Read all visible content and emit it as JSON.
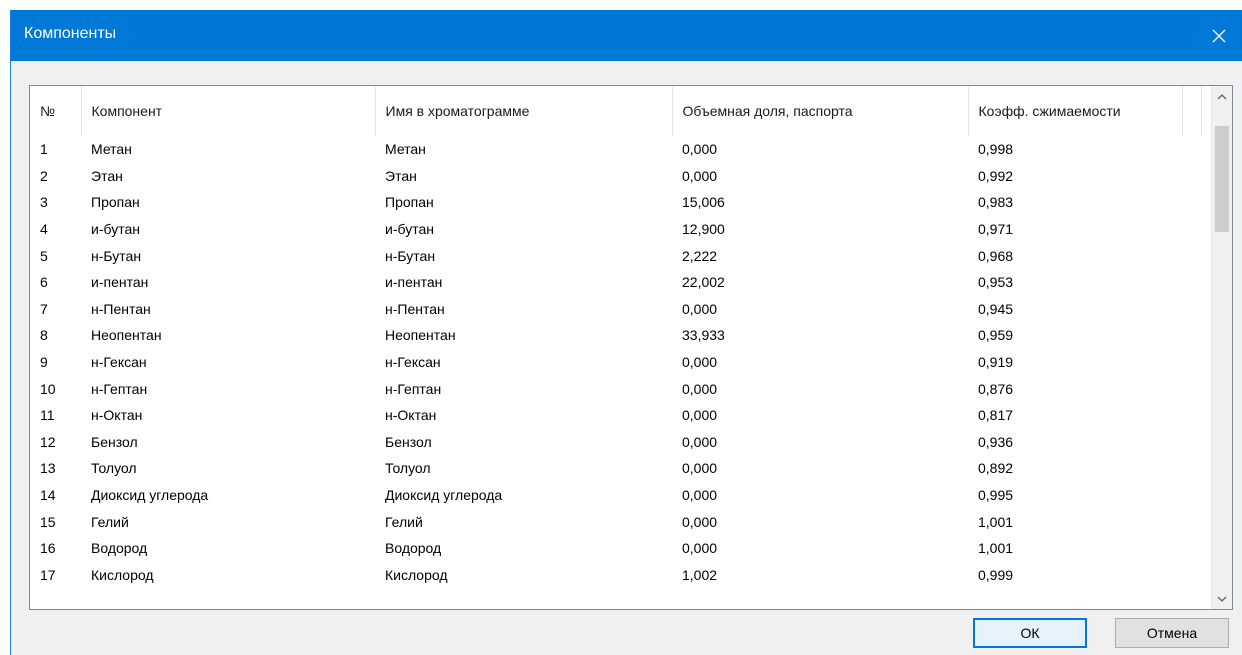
{
  "window": {
    "title": "Компоненты"
  },
  "table": {
    "columns": [
      "№",
      "Компонент",
      "Имя в хроматограмме",
      "Объемная доля, паспорта",
      "Коэфф. сжимаемости"
    ],
    "rows": [
      [
        "1",
        "Метан",
        "Метан",
        "0,000",
        "0,998"
      ],
      [
        "2",
        "Этан",
        "Этан",
        "0,000",
        "0,992"
      ],
      [
        "3",
        "Пропан",
        "Пропан",
        "15,006",
        "0,983"
      ],
      [
        "4",
        "и-бутан",
        "и-бутан",
        "12,900",
        "0,971"
      ],
      [
        "5",
        "н-Бутан",
        "н-Бутан",
        "2,222",
        "0,968"
      ],
      [
        "6",
        "и-пентан",
        "и-пентан",
        "22,002",
        "0,953"
      ],
      [
        "7",
        "н-Пентан",
        "н-Пентан",
        "0,000",
        "0,945"
      ],
      [
        "8",
        "Неопентан",
        "Неопентан",
        "33,933",
        "0,959"
      ],
      [
        "9",
        "н-Гексан",
        "н-Гексан",
        "0,000",
        "0,919"
      ],
      [
        "10",
        "н-Гептан",
        "н-Гептан",
        "0,000",
        "0,876"
      ],
      [
        "11",
        "н-Октан",
        "н-Октан",
        "0,000",
        "0,817"
      ],
      [
        "12",
        "Бензол",
        "Бензол",
        "0,000",
        "0,936"
      ],
      [
        "13",
        "Толуол",
        "Толуол",
        "0,000",
        "0,892"
      ],
      [
        "14",
        "Диоксид углерода",
        "Диоксид углерода",
        "0,000",
        "0,995"
      ],
      [
        "15",
        "Гелий",
        "Гелий",
        "0,000",
        "1,001"
      ],
      [
        "16",
        "Водород",
        "Водород",
        "0,000",
        "1,001"
      ],
      [
        "17",
        "Кислород",
        "Кислород",
        "1,002",
        "0,999"
      ]
    ]
  },
  "buttons": {
    "ok_label": "ОК",
    "cancel_label": "Отмена"
  },
  "colors": {
    "titlebar": "#0078d7",
    "dialog_bg": "#f0f0f0"
  }
}
